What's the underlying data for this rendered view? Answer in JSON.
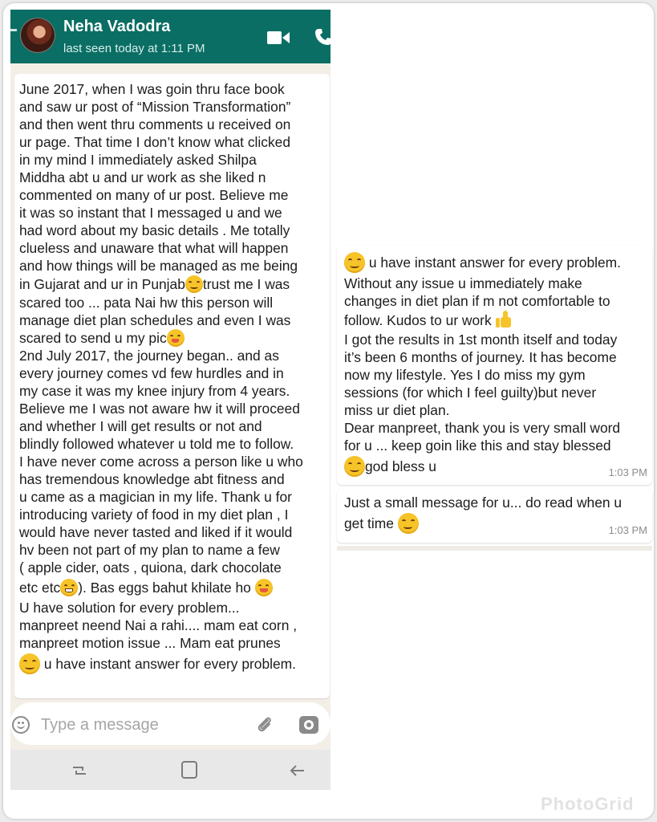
{
  "header": {
    "contact_name": "Neha Vadodra",
    "last_seen": "last seen today at 1:11 PM"
  },
  "left_message": {
    "lines_p1": [
      "June 2017, when I was goin thru face book",
      "and saw ur post of “Mission Transformation”",
      "and then went thru comments u received on",
      "ur page. That time I don’t know what clicked",
      "in my mind I immediately asked Shilpa",
      "Middha abt u and ur work as she liked n",
      "commented on many of ur post. Believe me",
      "it was so instant that I messaged u and we",
      "had word about my basic details . Me totally",
      "clueless and unaware that what will happen",
      "and how things will be managed as me being"
    ],
    "p1_line12_a": "in Gujarat and ur in Punjab",
    "p1_line12_b": "trust me I was",
    "p1_line13": "scared too ... pata Nai hw this person will",
    "p1_line14": "manage diet plan schedules and even I was",
    "p1_line15": "scared to send u my pic",
    "lines_p2": [
      "2nd July 2017, the journey began.. and as",
      "every journey comes vd few hurdles and in",
      "my case it was my knee injury from 4 years.",
      "Believe me I was not aware hw it will proceed",
      "and whether I will get results or not and",
      "blindly followed whatever u told me to follow.",
      "I have never come across a person like u who",
      "has tremendous knowledge abt fitness and",
      "u came as a magician in my life. Thank u for",
      "introducing variety of food in my diet plan , I",
      "would have never tasted and liked if it would",
      "hv been not part of my plan to name a few",
      "( apple cider, oats , quiona, dark chocolate"
    ],
    "p2_line14_a": "etc etc",
    "p2_line14_b": "). Bas eggs bahut khilate ho",
    "lines_p3": [
      "U have solution for every problem...",
      "manpreet neend Nai a rahi.... mam eat corn ,",
      "manpreet motion issue ... Mam eat prunes"
    ],
    "p3_last": " u have instant answer for every problem."
  },
  "right_message_1": {
    "line1": " u have instant answer for every problem.",
    "line2": "Without any issue u immediately make",
    "line3": "changes in diet plan if m not comfortable to",
    "line4": "follow. Kudos to ur work ",
    "lines_b": [
      "I got the results in 1st month itself and today",
      "it’s been 6 months of journey. It has become",
      "now my lifestyle. Yes I do miss my gym",
      "sessions (for which I feel guilty)but never",
      "miss ur diet plan.",
      "Dear manpreet, thank you is very small word",
      "for u ... keep goin like this and stay blessed"
    ],
    "last": "god bless u",
    "time": "1:03 PM"
  },
  "right_message_2": {
    "line1": "Just a small message for u... do read when u",
    "line2": "get time ",
    "time": "1:03 PM"
  },
  "input": {
    "placeholder": "Type a message"
  },
  "watermark": "PhotoGrid",
  "icons": {
    "video": "video-camera-icon",
    "call": "phone-icon",
    "emoji": "smiley-icon",
    "attach": "paperclip-icon",
    "camera": "camera-icon",
    "nav_recent": "recent-apps-icon",
    "nav_home": "home-icon",
    "nav_back": "back-icon"
  },
  "colors": {
    "header": "#0a6e64",
    "chat_bg": "#f3efe7",
    "bubble": "#ffffff",
    "timestamp": "#8c8c8c"
  }
}
